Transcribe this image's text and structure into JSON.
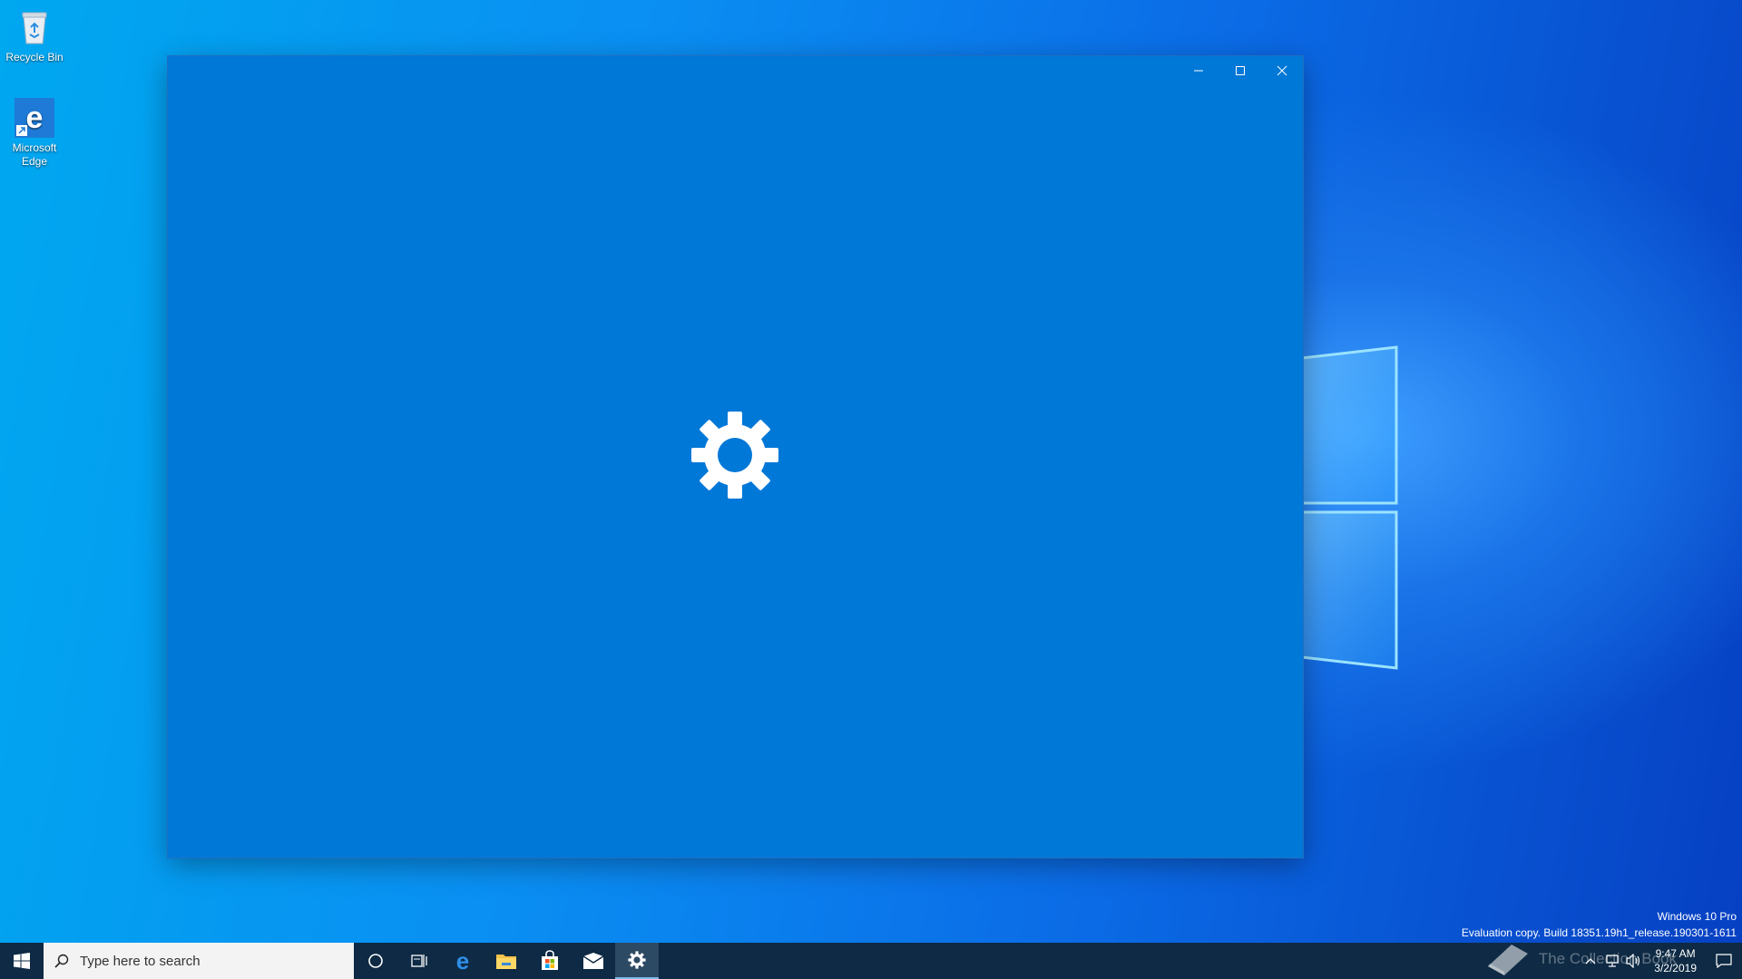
{
  "desktop": {
    "icons": [
      {
        "label": "Recycle Bin",
        "icon": "recycle-bin-icon"
      },
      {
        "label": "Microsoft Edge",
        "icon": "edge-icon"
      }
    ],
    "watermark": {
      "line1": "Windows 10 Pro",
      "line2": "Evaluation copy. Build 18351.19h1_release.190301-1611"
    }
  },
  "window": {
    "title": "",
    "background": "#0078d7",
    "splash_icon": "gear-icon",
    "buttons": {
      "minimize": "minimize-icon",
      "maximize": "maximize-icon",
      "close": "close-icon"
    }
  },
  "taskbar": {
    "background": "#0e2a44",
    "search_placeholder": "Type here to search",
    "pinned": [
      "cortana-icon",
      "task-view-icon",
      "edge-icon",
      "file-explorer-icon",
      "store-icon",
      "mail-icon",
      "settings-icon"
    ],
    "active": "settings-icon",
    "clock": {
      "time": "9:47 AM",
      "date": "3/2/2019"
    },
    "overlay_text": "The Collection Book"
  }
}
